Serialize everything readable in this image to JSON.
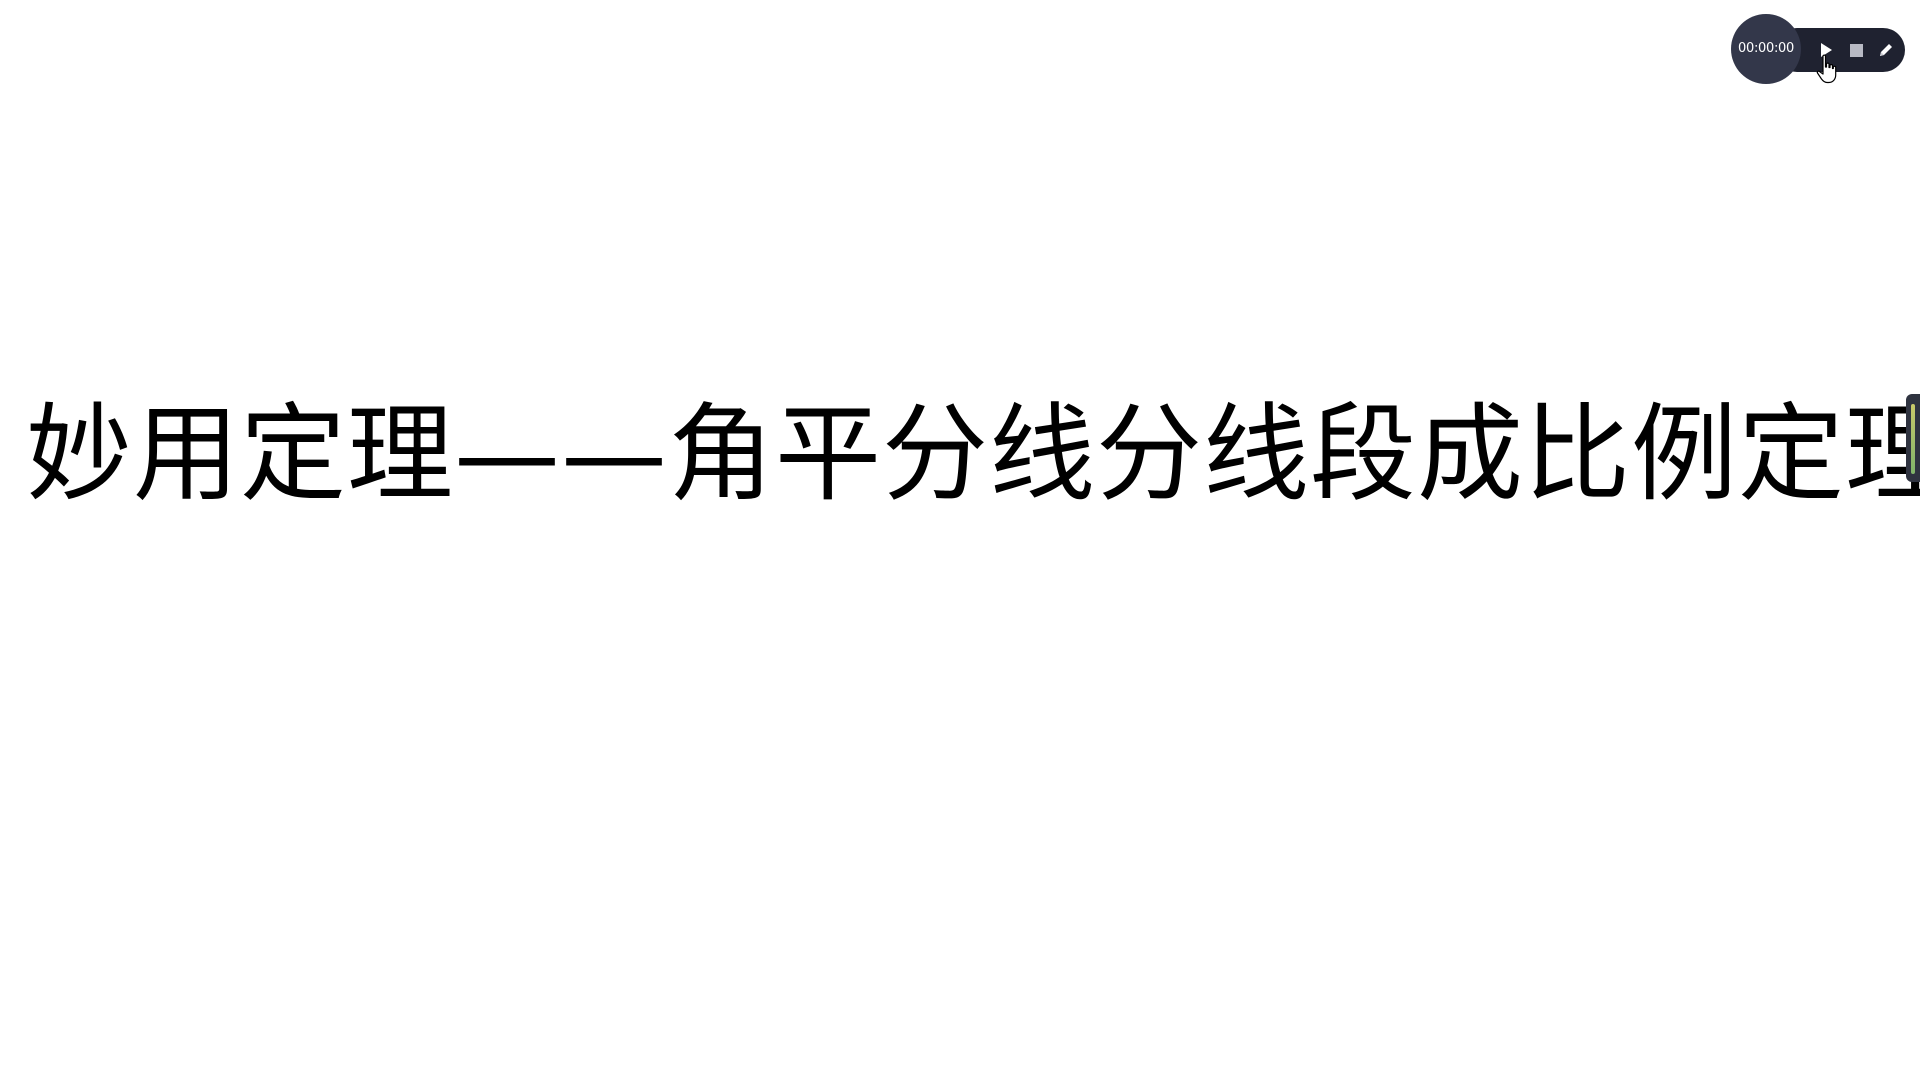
{
  "slide": {
    "title": "妙用定理——角平分线分线段成比例定理"
  },
  "recorder": {
    "timer": "00:00:00",
    "icons": {
      "play": "play-icon",
      "stop": "stop-icon",
      "pen": "pen-icon"
    },
    "colors": {
      "pill": "#1f2230",
      "timer_bg": "#33374a",
      "icon": "#ffffff"
    }
  }
}
